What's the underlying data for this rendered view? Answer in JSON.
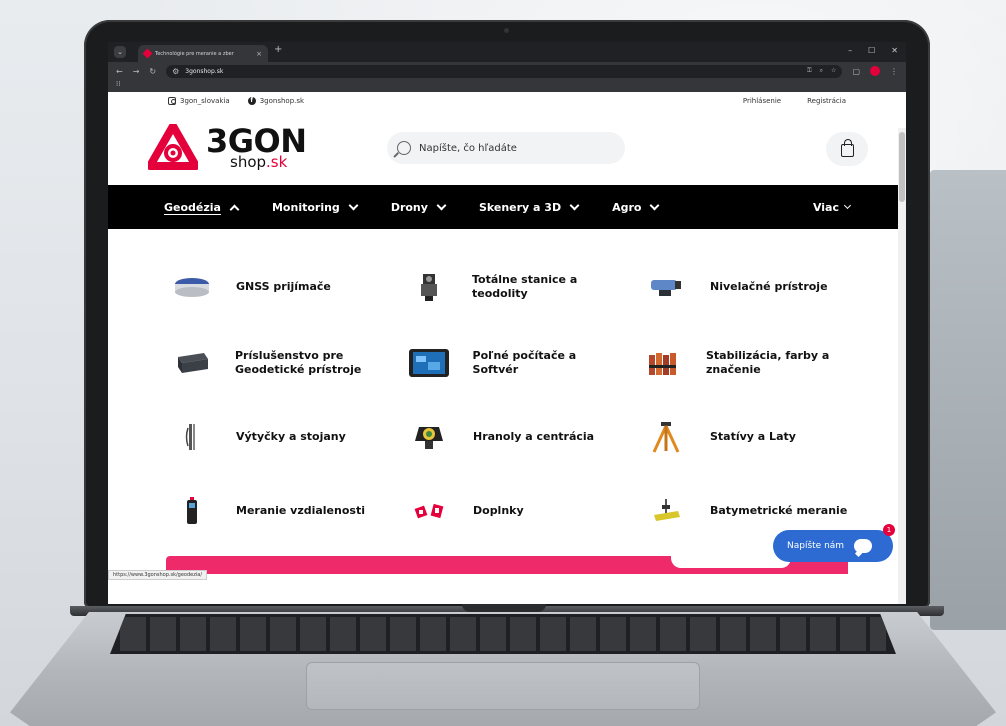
{
  "browser": {
    "tab_title": "Technológie pre meranie a zber",
    "tab_close": "×",
    "tab_new": "+",
    "url": "3gonshop.sk",
    "status_url": "https://www.3gonshop.sk/geodezia/",
    "window_controls": [
      "–",
      "☐",
      "✕"
    ]
  },
  "topbar": {
    "instagram": "3gon_slovakia",
    "facebook": "3gonshop.sk",
    "login": "Prihlásenie",
    "register": "Registrácia"
  },
  "header": {
    "logo_main": "3GON",
    "logo_sub_a": "shop",
    "logo_sub_b": ".sk",
    "search_placeholder": "Napíšte, čo hľadáte"
  },
  "nav": {
    "items": [
      {
        "label": "Geodézia",
        "active": true
      },
      {
        "label": "Monitoring"
      },
      {
        "label": "Drony"
      },
      {
        "label": "Skenery a 3D"
      },
      {
        "label": "Agro"
      }
    ],
    "more": "Viac"
  },
  "menu": {
    "items": [
      {
        "label": "GNSS prijímače",
        "icon": "gnss-receiver-icon"
      },
      {
        "label": "Totálne stanice a teodolity",
        "icon": "total-station-icon"
      },
      {
        "label": "Nivelačné prístroje",
        "icon": "level-instrument-icon"
      },
      {
        "label": "Príslušenstvo pre Geodetické prístroje",
        "icon": "accessory-case-icon"
      },
      {
        "label": "Poľné počítače a Softvér",
        "icon": "field-computer-icon"
      },
      {
        "label": "Stabilizácia, farby a značenie",
        "icon": "spray-cans-icon"
      },
      {
        "label": "Výtyčky a stojany",
        "icon": "survey-pole-icon"
      },
      {
        "label": "Hranoly a centrácia",
        "icon": "prism-icon"
      },
      {
        "label": "Statívy a Laty",
        "icon": "tripod-icon"
      },
      {
        "label": "Meranie vzdialenosti",
        "icon": "laser-distance-meter-icon"
      },
      {
        "label": "Doplnky",
        "icon": "accessories-icon"
      },
      {
        "label": "Batymetrické meranie",
        "icon": "bathymetry-icon"
      }
    ]
  },
  "chat": {
    "label": "Napíšte nám",
    "badge": "1"
  },
  "colors": {
    "brand_red": "#e4003a",
    "nav_bg": "#000000",
    "chat_blue": "#2d6bd3",
    "promo_pink": "#ee2a6b"
  }
}
